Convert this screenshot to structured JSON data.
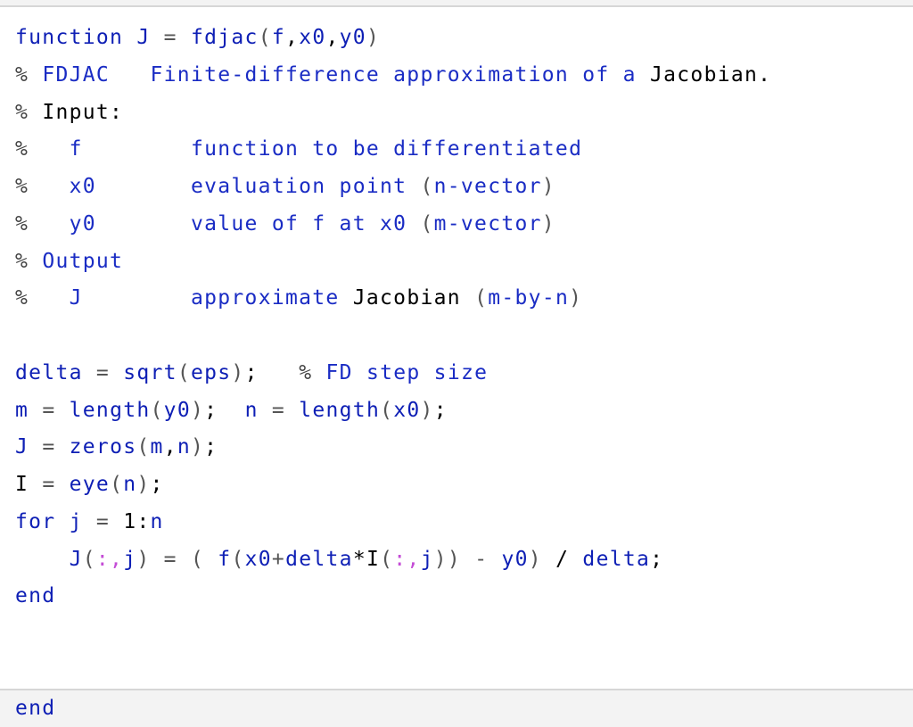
{
  "colors": {
    "keyword": "#0e1fb5",
    "identifier": "#0e1fb5",
    "comment": "#1a2cc4",
    "operator": "#555555",
    "plain": "#000000",
    "colon_index": "#c44cd6",
    "panel_background": "#ffffff",
    "page_background": "#f3f3f3",
    "border": "#d6d6d6"
  },
  "code": {
    "lines": [
      {
        "segments": [
          {
            "text": "function",
            "cls": "kw"
          },
          {
            "text": " "
          },
          {
            "text": "J",
            "cls": "id"
          },
          {
            "text": " "
          },
          {
            "text": "=",
            "cls": "op"
          },
          {
            "text": " "
          },
          {
            "text": "fdjac",
            "cls": "id"
          },
          {
            "text": "(",
            "cls": "pn"
          },
          {
            "text": "f",
            "cls": "id"
          },
          {
            "text": ",",
            "cls": "bk"
          },
          {
            "text": "x0",
            "cls": "id"
          },
          {
            "text": ",",
            "cls": "bk"
          },
          {
            "text": "y0",
            "cls": "id"
          },
          {
            "text": ")",
            "cls": "pn"
          }
        ]
      },
      {
        "segments": [
          {
            "text": "%",
            "cls": "cmp"
          },
          {
            "text": " "
          },
          {
            "text": "FDJAC",
            "cls": "cm"
          },
          {
            "text": "   "
          },
          {
            "text": "Finite-difference approximation of a",
            "cls": "cm"
          },
          {
            "text": " "
          },
          {
            "text": "Jacobian.",
            "cls": "bk"
          }
        ]
      },
      {
        "segments": [
          {
            "text": "%",
            "cls": "cmp"
          },
          {
            "text": " "
          },
          {
            "text": "Input:",
            "cls": "bk"
          }
        ]
      },
      {
        "segments": [
          {
            "text": "%",
            "cls": "cmp"
          },
          {
            "text": "   "
          },
          {
            "text": "f",
            "cls": "cm"
          },
          {
            "text": "        "
          },
          {
            "text": "function to be differentiated",
            "cls": "cm"
          }
        ]
      },
      {
        "segments": [
          {
            "text": "%",
            "cls": "cmp"
          },
          {
            "text": "   "
          },
          {
            "text": "x0",
            "cls": "cm"
          },
          {
            "text": "       "
          },
          {
            "text": "evaluation point",
            "cls": "cm"
          },
          {
            "text": " "
          },
          {
            "text": "(",
            "cls": "pn"
          },
          {
            "text": "n-vector",
            "cls": "cm"
          },
          {
            "text": ")",
            "cls": "pn"
          }
        ]
      },
      {
        "segments": [
          {
            "text": "%",
            "cls": "cmp"
          },
          {
            "text": "   "
          },
          {
            "text": "y0",
            "cls": "cm"
          },
          {
            "text": "       "
          },
          {
            "text": "value of f at x0",
            "cls": "cm"
          },
          {
            "text": " "
          },
          {
            "text": "(",
            "cls": "pn"
          },
          {
            "text": "m-vector",
            "cls": "cm"
          },
          {
            "text": ")",
            "cls": "pn"
          }
        ]
      },
      {
        "segments": [
          {
            "text": "%",
            "cls": "cmp"
          },
          {
            "text": " "
          },
          {
            "text": "Output",
            "cls": "cm"
          }
        ]
      },
      {
        "segments": [
          {
            "text": "%",
            "cls": "cmp"
          },
          {
            "text": "   "
          },
          {
            "text": "J",
            "cls": "cm"
          },
          {
            "text": "        "
          },
          {
            "text": "approximate",
            "cls": "cm"
          },
          {
            "text": " "
          },
          {
            "text": "Jacobian",
            "cls": "bk"
          },
          {
            "text": " "
          },
          {
            "text": "(",
            "cls": "pn"
          },
          {
            "text": "m-by-n",
            "cls": "cm"
          },
          {
            "text": ")",
            "cls": "pn"
          }
        ]
      },
      {
        "segments": [
          {
            "text": " "
          }
        ]
      },
      {
        "segments": [
          {
            "text": "delta",
            "cls": "id"
          },
          {
            "text": " "
          },
          {
            "text": "=",
            "cls": "op"
          },
          {
            "text": " "
          },
          {
            "text": "sqrt",
            "cls": "id"
          },
          {
            "text": "(",
            "cls": "pn"
          },
          {
            "text": "eps",
            "cls": "id"
          },
          {
            "text": ")",
            "cls": "pn"
          },
          {
            "text": ";",
            "cls": "bk"
          },
          {
            "text": "   "
          },
          {
            "text": "%",
            "cls": "cmp"
          },
          {
            "text": " "
          },
          {
            "text": "FD step size",
            "cls": "cm"
          }
        ]
      },
      {
        "segments": [
          {
            "text": "m",
            "cls": "id"
          },
          {
            "text": " "
          },
          {
            "text": "=",
            "cls": "op"
          },
          {
            "text": " "
          },
          {
            "text": "length",
            "cls": "id"
          },
          {
            "text": "(",
            "cls": "pn"
          },
          {
            "text": "y0",
            "cls": "id"
          },
          {
            "text": ")",
            "cls": "pn"
          },
          {
            "text": ";",
            "cls": "bk"
          },
          {
            "text": "  "
          },
          {
            "text": "n",
            "cls": "id"
          },
          {
            "text": " "
          },
          {
            "text": "=",
            "cls": "op"
          },
          {
            "text": " "
          },
          {
            "text": "length",
            "cls": "id"
          },
          {
            "text": "(",
            "cls": "pn"
          },
          {
            "text": "x0",
            "cls": "id"
          },
          {
            "text": ")",
            "cls": "pn"
          },
          {
            "text": ";",
            "cls": "bk"
          }
        ]
      },
      {
        "segments": [
          {
            "text": "J",
            "cls": "id"
          },
          {
            "text": " "
          },
          {
            "text": "=",
            "cls": "op"
          },
          {
            "text": " "
          },
          {
            "text": "zeros",
            "cls": "id"
          },
          {
            "text": "(",
            "cls": "pn"
          },
          {
            "text": "m",
            "cls": "id"
          },
          {
            "text": ",",
            "cls": "bk"
          },
          {
            "text": "n",
            "cls": "id"
          },
          {
            "text": ")",
            "cls": "pn"
          },
          {
            "text": ";",
            "cls": "bk"
          }
        ]
      },
      {
        "segments": [
          {
            "text": "I",
            "cls": "bk"
          },
          {
            "text": " "
          },
          {
            "text": "=",
            "cls": "op"
          },
          {
            "text": " "
          },
          {
            "text": "eye",
            "cls": "id"
          },
          {
            "text": "(",
            "cls": "pn"
          },
          {
            "text": "n",
            "cls": "id"
          },
          {
            "text": ")",
            "cls": "pn"
          },
          {
            "text": ";",
            "cls": "bk"
          }
        ]
      },
      {
        "segments": [
          {
            "text": "for",
            "cls": "kw"
          },
          {
            "text": " "
          },
          {
            "text": "j",
            "cls": "id"
          },
          {
            "text": " "
          },
          {
            "text": "=",
            "cls": "op"
          },
          {
            "text": " "
          },
          {
            "text": "1:",
            "cls": "bk"
          },
          {
            "text": "n",
            "cls": "id"
          }
        ]
      },
      {
        "segments": [
          {
            "text": "    "
          },
          {
            "text": "J",
            "cls": "id"
          },
          {
            "text": "(",
            "cls": "pn"
          },
          {
            "text": ":,",
            "cls": "mg"
          },
          {
            "text": "j",
            "cls": "id"
          },
          {
            "text": ")",
            "cls": "pn"
          },
          {
            "text": " "
          },
          {
            "text": "=",
            "cls": "op"
          },
          {
            "text": " "
          },
          {
            "text": "(",
            "cls": "pn"
          },
          {
            "text": " "
          },
          {
            "text": "f",
            "cls": "id"
          },
          {
            "text": "(",
            "cls": "pn"
          },
          {
            "text": "x0",
            "cls": "id"
          },
          {
            "text": "+",
            "cls": "op"
          },
          {
            "text": "delta",
            "cls": "id"
          },
          {
            "text": "*",
            "cls": "bk"
          },
          {
            "text": "I",
            "cls": "bk"
          },
          {
            "text": "(",
            "cls": "pn"
          },
          {
            "text": ":,",
            "cls": "mg"
          },
          {
            "text": "j",
            "cls": "id"
          },
          {
            "text": "))",
            "cls": "pn"
          },
          {
            "text": " "
          },
          {
            "text": "-",
            "cls": "op"
          },
          {
            "text": " "
          },
          {
            "text": "y0",
            "cls": "id"
          },
          {
            "text": ")",
            "cls": "pn"
          },
          {
            "text": " "
          },
          {
            "text": "/",
            "cls": "bk"
          },
          {
            "text": " "
          },
          {
            "text": "delta",
            "cls": "id"
          },
          {
            "text": ";",
            "cls": "bk"
          }
        ]
      },
      {
        "segments": [
          {
            "text": "end",
            "cls": "kw"
          }
        ]
      },
      {
        "segments": [
          {
            "text": " "
          }
        ]
      },
      {
        "segments": [
          {
            "text": " "
          }
        ]
      },
      {
        "segments": [
          {
            "text": "end",
            "cls": "kw"
          }
        ]
      }
    ]
  }
}
